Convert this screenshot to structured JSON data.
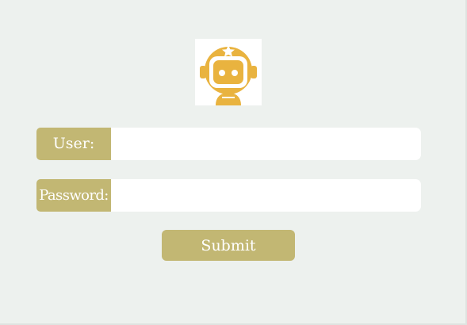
{
  "logo": {
    "icon": "robot-astronaut-icon",
    "color": "#e9b33f"
  },
  "login_form": {
    "user_label": "User:",
    "user_value": "",
    "password_label": "Password:",
    "password_value": "",
    "submit_label": "Submit"
  },
  "colors": {
    "background": "#edf1ee",
    "accent": "#c2b773",
    "input_background": "#ffffff"
  }
}
